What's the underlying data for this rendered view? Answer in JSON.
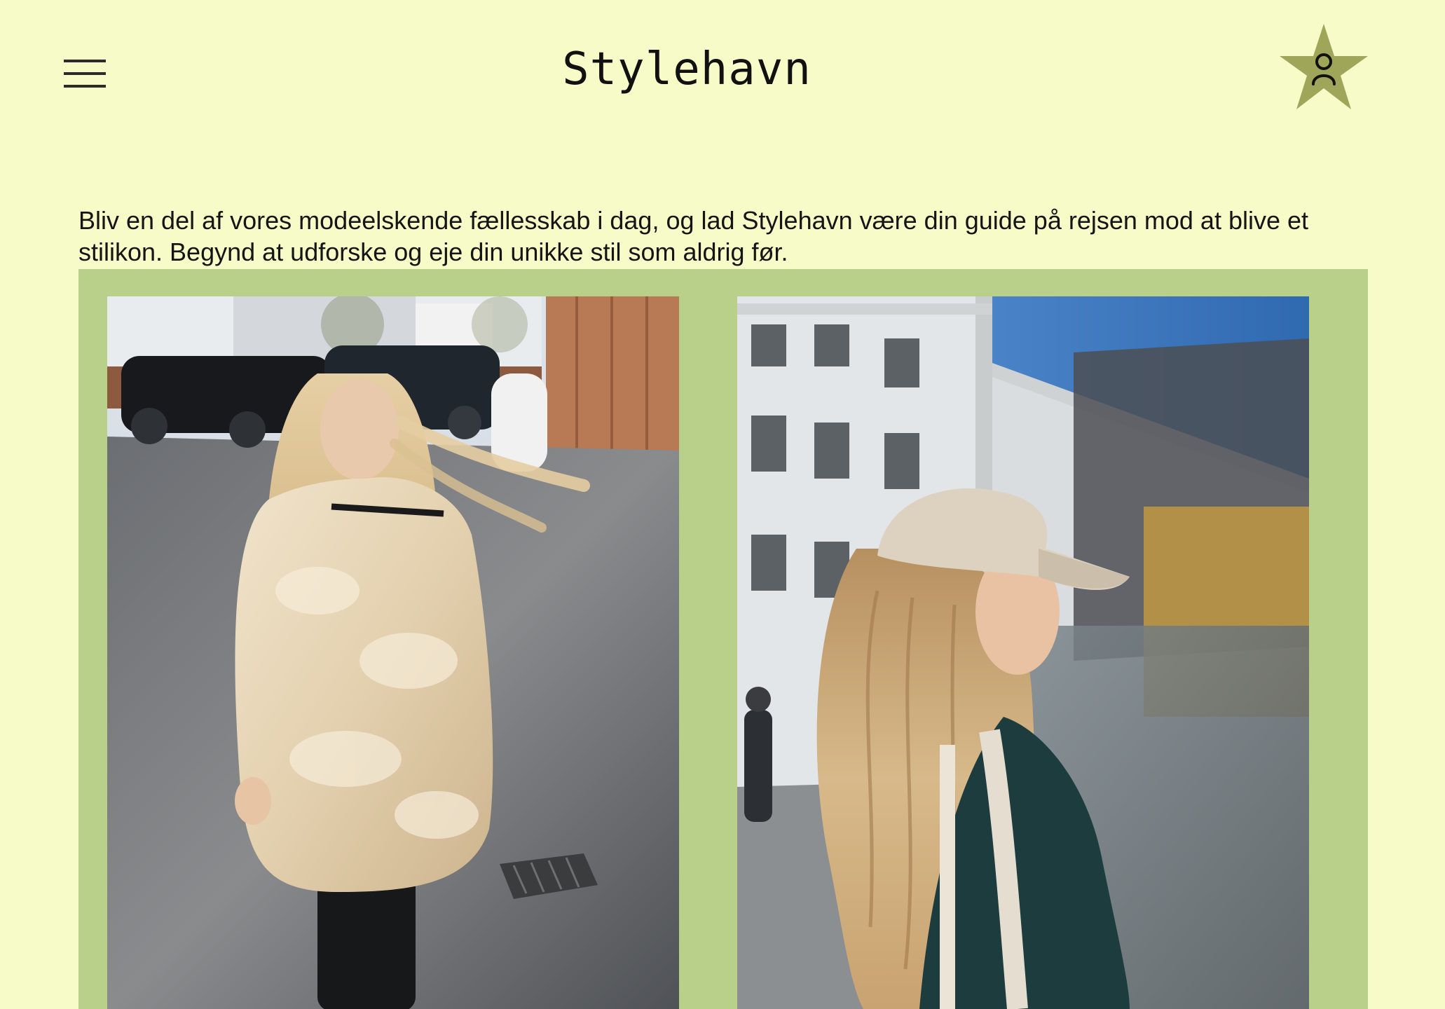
{
  "header": {
    "site_title": "Stylehavn",
    "menu_icon": "hamburger-menu-icon",
    "account_icon": "user-icon",
    "account_badge_shape": "star",
    "account_badge_color": "#9fa65a"
  },
  "intro": {
    "text": "Bliv en del af vores modeelskende fællesskab i dag, og lad Stylehavn være din guide på rejsen mod at blive et stilikon. Begynd at udforske og eje din unikke stil som aldrig før."
  },
  "colors": {
    "page_background": "#f7fbc8",
    "gallery_background": "#b8d08a"
  }
}
